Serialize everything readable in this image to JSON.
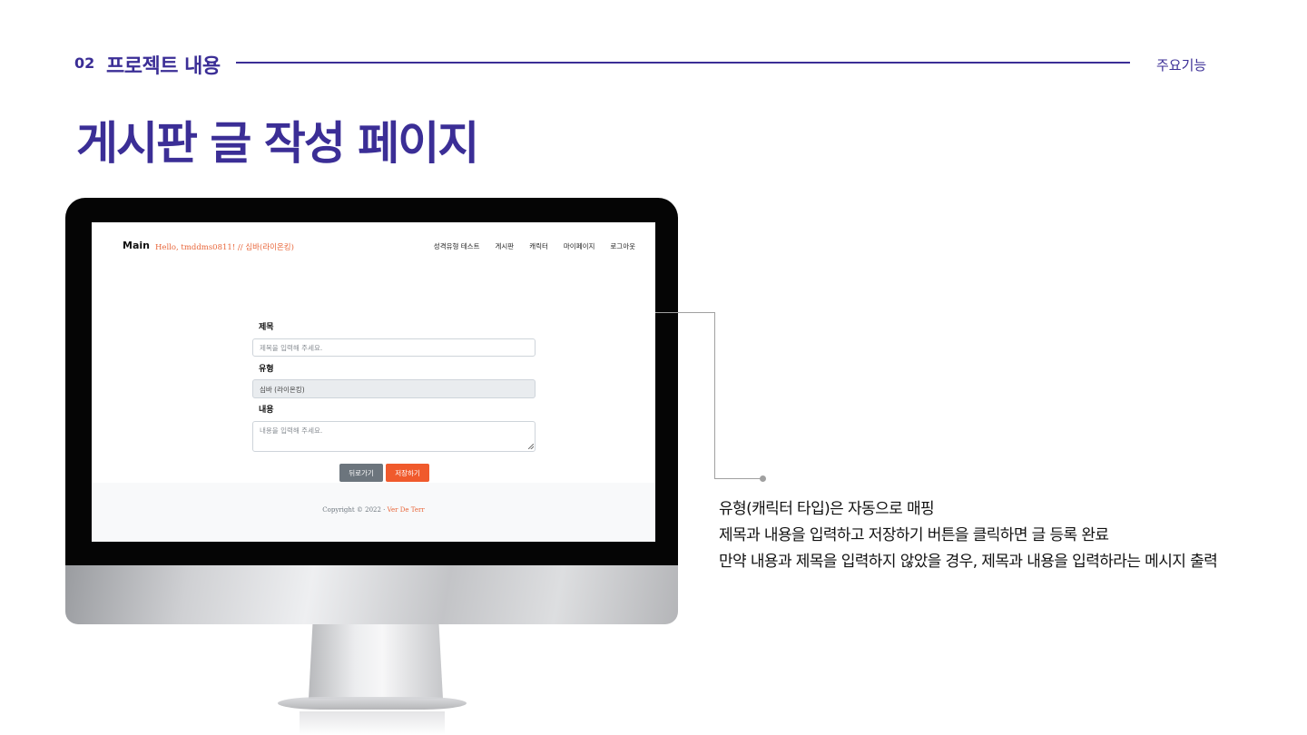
{
  "slide": {
    "number": "02",
    "section_title": "프로젝트 내용",
    "tag": "주요기능",
    "heading": "게시판 글 작성 페이지"
  },
  "app": {
    "brand": "Main",
    "greeting": "Hello, tmddms0811! // 심바(라이온킹)",
    "nav": [
      "성격유형 테스트",
      "게시판",
      "캐릭터",
      "마이페이지",
      "로그아웃"
    ],
    "form": {
      "title_label": "제목",
      "title_placeholder": "제목을 입력해 주세요.",
      "type_label": "유형",
      "type_value": "심바 (라이온킹)",
      "content_label": "내용",
      "content_placeholder": "내용을 입력해 주세요."
    },
    "buttons": {
      "back": "뒤로가기",
      "save": "저장하기"
    },
    "footer": {
      "copyright": "Copyright © 2022 · ",
      "link": "Ver De Terr"
    }
  },
  "description": [
    "유형(캐릭터 타입)은 자동으로 매핑",
    "제목과 내용을 입력하고 저장하기 버튼을 클릭하면 글 등록 완료",
    "만약 내용과 제목을 입력하지 않았을 경우, 제목과 내용을 입력하라는 메시지 출력"
  ],
  "colors": {
    "brand_purple": "#3b2e96",
    "accent_orange": "#f05a2c",
    "button_gray": "#6c757d"
  }
}
